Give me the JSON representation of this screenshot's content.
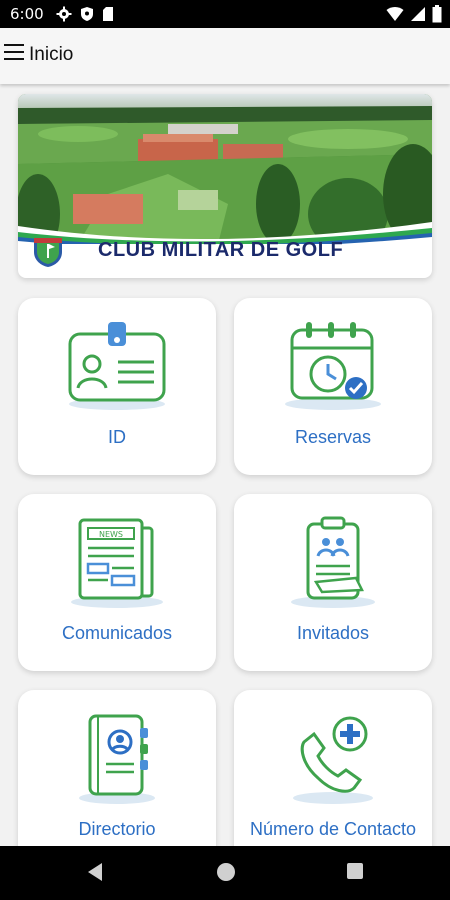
{
  "status_bar": {
    "time": "6:00"
  },
  "app_bar": {
    "title": "Inicio"
  },
  "banner": {
    "club_name": "CLUB MILITAR DE GOLF"
  },
  "menu": [
    {
      "label": "ID",
      "icon": "id-card-icon"
    },
    {
      "label": "Reservas",
      "icon": "calendar-clock-icon"
    },
    {
      "label": "Comunicados",
      "icon": "newspaper-icon"
    },
    {
      "label": "Invitados",
      "icon": "clipboard-guests-icon"
    },
    {
      "label": "Directorio",
      "icon": "address-book-icon"
    },
    {
      "label": "Número de Contacto",
      "icon": "phone-plus-icon"
    }
  ],
  "colors": {
    "accent_green": "#3fa34d",
    "label_blue": "#2d6fc4",
    "title_navy": "#1b2a6b"
  }
}
